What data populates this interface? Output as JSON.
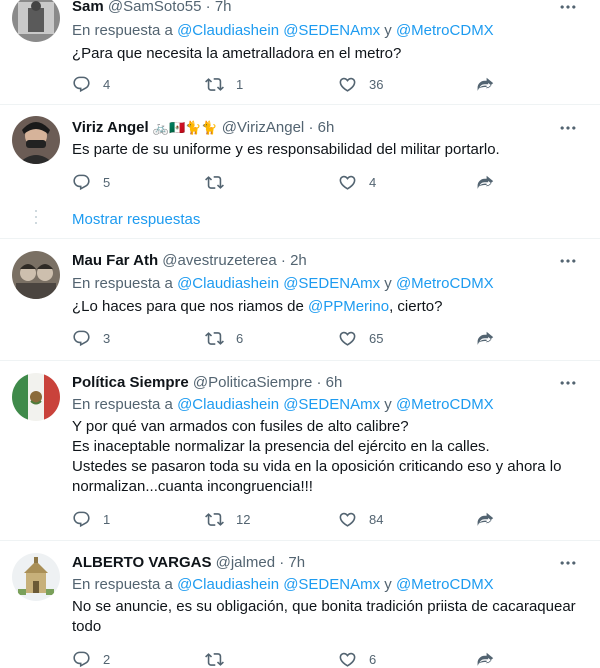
{
  "colors": {
    "accent": "#1d9bf0",
    "text": "#0f1419",
    "muted": "#536471",
    "divider": "#eff3f4"
  },
  "tweets": [
    {
      "name": "Sam",
      "handle": "@SamSoto55",
      "sep": "·",
      "time": "7h",
      "reply_prefix": "En respuesta a",
      "reply_users": "@Claudiashein @SEDENAmx",
      "reply_and": "y",
      "reply_last": "@MetroCDMX",
      "text": "¿Para que necesita la ametralladora en el metro?",
      "replies": "4",
      "retweets": "1",
      "likes": "36"
    },
    {
      "name": "Viriz Angel",
      "name_emojis": "🚲🇲🇽🐈🐈",
      "handle": "@VirizAngel",
      "sep": "·",
      "time": "6h",
      "text": "Es parte de su uniforme y es responsabilidad del militar portarlo.",
      "replies": "5",
      "retweets": "",
      "likes": "4"
    },
    {
      "show_more": "Mostrar respuestas"
    },
    {
      "name": "Mau Far Ath",
      "handle": "@avestruzeterea",
      "sep": "·",
      "time": "2h",
      "reply_prefix": "En respuesta a",
      "reply_users": "@Claudiashein @SEDENAmx",
      "reply_and": "y",
      "reply_last": "@MetroCDMX",
      "text_before": "¿Lo haces para que nos riamos de",
      "text_mention": "@PPMerino",
      "text_after": ", cierto?",
      "replies": "3",
      "retweets": "6",
      "likes": "65"
    },
    {
      "name": "Política Siempre",
      "handle": "@PoliticaSiempre",
      "sep": "·",
      "time": "6h",
      "reply_prefix": "En respuesta a",
      "reply_users": "@Claudiashein @SEDENAmx",
      "reply_and": "y",
      "reply_last": "@MetroCDMX",
      "lines": [
        "Y por qué van armados con fusiles de alto calibre?",
        "Es inaceptable normalizar la presencia del ejército en la calles.",
        "Ustedes se pasaron toda su vida en la oposición criticando eso y ahora lo",
        "normalizan...cuanta incongruencia!!!"
      ],
      "replies": "1",
      "retweets": "12",
      "likes": "84"
    },
    {
      "name": "ALBERTO VARGAS",
      "handle": "@jalmed",
      "sep": "·",
      "time": "7h",
      "reply_prefix": "En respuesta a",
      "reply_users": "@Claudiashein @SEDENAmx",
      "reply_and": "y",
      "reply_last": "@MetroCDMX",
      "lines": [
        "No se anuncie, es su obligación, que bonita tradición priista de cacaraquear",
        "todo"
      ],
      "replies": "2",
      "retweets": "",
      "likes": "6"
    }
  ]
}
